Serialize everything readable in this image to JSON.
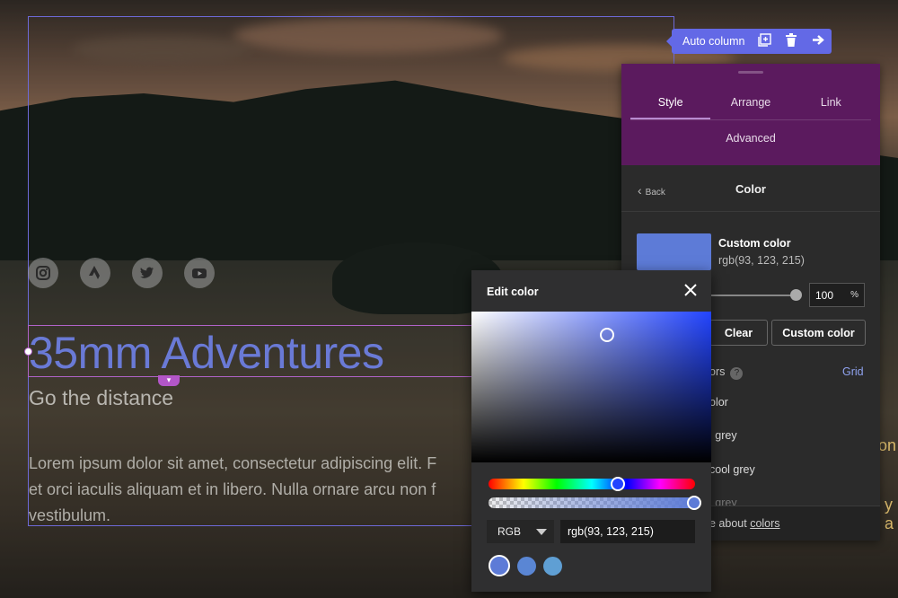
{
  "toolbar": {
    "label": "Auto column",
    "add_icon": "add-column-icon",
    "delete_icon": "trash-icon",
    "next_icon": "arrow-right-icon"
  },
  "hero": {
    "title": "35mm Adventures",
    "subtitle": "Go the distance",
    "body": "Lorem ipsum dolor sit amet, consectetur adipiscing elit. F… et orci iaculis aliquam et in libero. Nulla ornare arcu non f… vestibulum.",
    "body_lines": [
      "Lorem ipsum dolor sit amet, consectetur adipiscing elit. F",
      "et orci iaculis aliquam et in libero. Nulla ornare arcu non f",
      "vestibulum."
    ],
    "social_icons": [
      "instagram-icon",
      "strava-icon",
      "twitter-icon",
      "youtube-icon"
    ],
    "title_color": "#6a7ad6",
    "right_fragments": [
      "on",
      "y a"
    ]
  },
  "panel": {
    "tabs": [
      "Style",
      "Arrange",
      "Link"
    ],
    "active_tab": "Style",
    "advanced_tab": "Advanced",
    "back_label": "Back",
    "section_title": "Color",
    "custom_color_name": "Custom color",
    "custom_color_value": "rgb(93, 123, 215)",
    "opacity_value": "100",
    "opacity_unit": "%",
    "clear_button": "Clear",
    "custom_color_button": "Custom color",
    "colors_label": "ors",
    "help_mark": "?",
    "grid_link": "Grid",
    "list_items": [
      "olor",
      "l grey",
      "cool grey",
      "l grey"
    ],
    "footer_prefix": "e about",
    "footer_link": "colors",
    "header_color": "#5b1a5e"
  },
  "edit_color": {
    "title": "Edit color",
    "close_icon": "close-icon",
    "mode": "RGB",
    "value": "rgb(93, 123, 215)",
    "opacity_fraction": 1.0,
    "recent_swatches": [
      "#5d7bd7",
      "#5a86d4",
      "#5f9fd4"
    ],
    "selected_color": "#5d7bd7"
  }
}
